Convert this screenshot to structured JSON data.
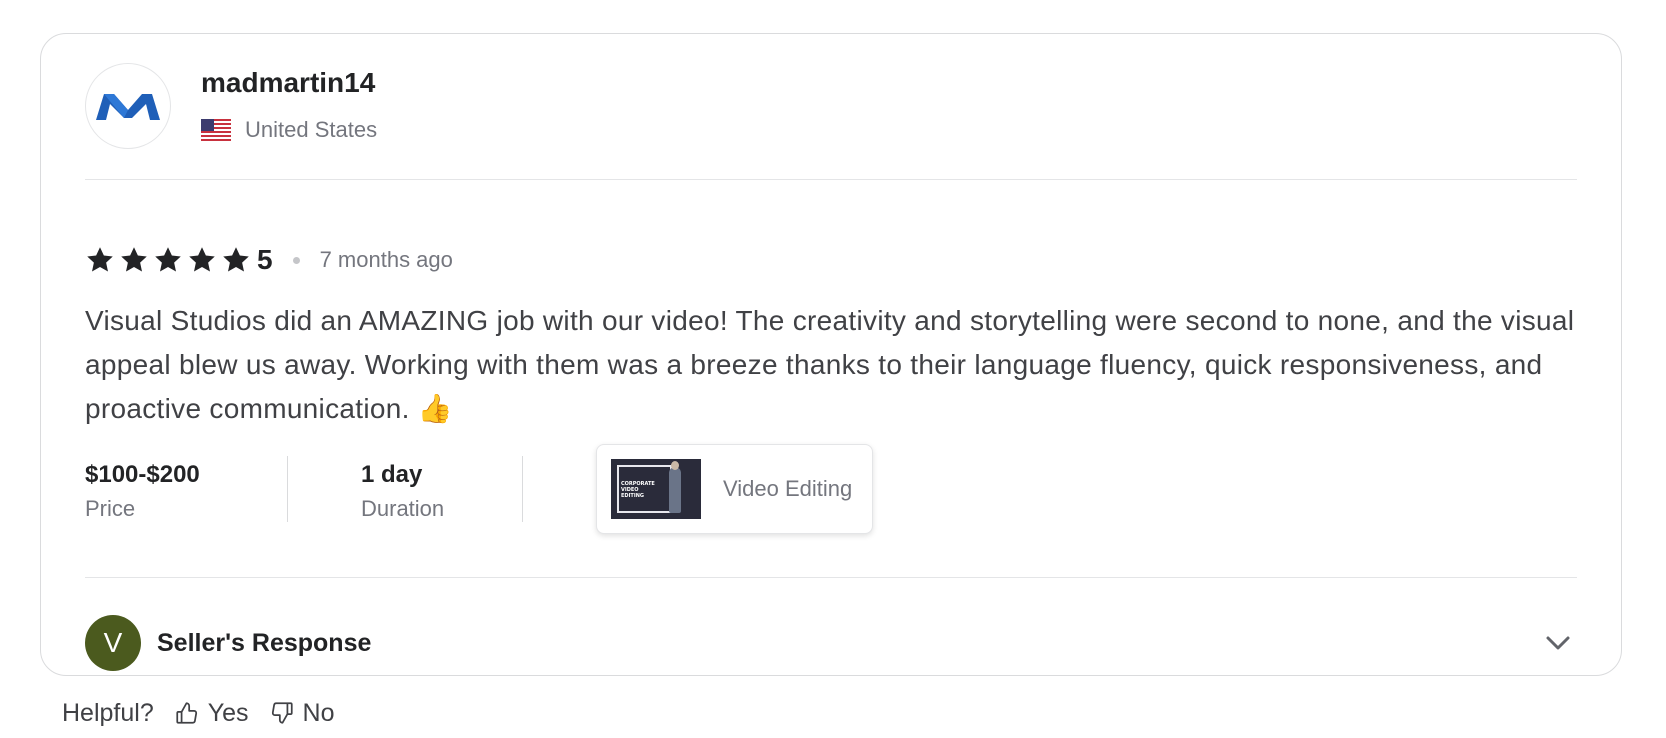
{
  "review": {
    "username": "madmartin14",
    "avatar_letter": "M",
    "country": "United States",
    "rating": "5",
    "stars_filled": 5,
    "stars_total": 5,
    "time": "7 months ago",
    "text": "Visual Studios did an AMAZING job with our video! The creativity and storytelling were second to none, and the visual appeal blew us away. Working with them was a breeze thanks to their language fluency, quick responsiveness, and proactive communication. 👍",
    "price_value": "$100-$200",
    "price_label": "Price",
    "duration_value": "1 day",
    "duration_label": "Duration",
    "gig_thumbnail_text": "CORPORATE VIDEO EDITING",
    "gig_name": "Video Editing"
  },
  "seller_response": {
    "avatar_letter": "V",
    "label": "Seller's Response",
    "avatar_color": "#4b5a1e"
  },
  "helpful": {
    "label": "Helpful?",
    "yes_label": "Yes",
    "no_label": "No"
  },
  "colors": {
    "text_primary": "#222325",
    "text_secondary": "#74767e",
    "border": "#dadbdd",
    "logo_blue": "#1f5fb8"
  },
  "icons": {
    "avatar_logo": "m-logo-icon",
    "flag": "us-flag-icon",
    "star": "star-icon",
    "expand": "chevron-down-icon",
    "yes": "thumbs-up-icon",
    "no": "thumbs-down-icon"
  }
}
